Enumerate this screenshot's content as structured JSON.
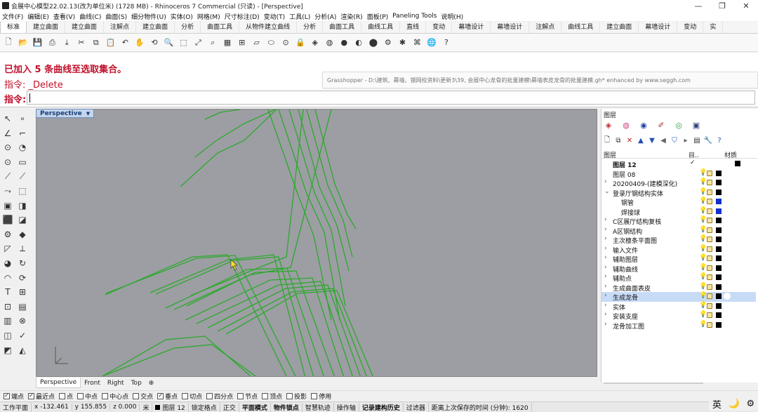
{
  "window": {
    "title": "会展中心模型22.02.13(改为单位米) (1728 MB) - Rhinoceros 7 Commercial (只读) - [Perspective]",
    "controls": [
      "—",
      "❐",
      "✕"
    ]
  },
  "menu": [
    "文件(F)",
    "编辑(E)",
    "查看(V)",
    "曲线(C)",
    "曲面(S)",
    "细分物件(U)",
    "实体(O)",
    "网格(M)",
    "尺寸标注(D)",
    "变动(T)",
    "工具(L)",
    "分析(A)",
    "渲染(R)",
    "面板(P)",
    "Paneling Tools",
    "说明(H)"
  ],
  "tabs": [
    "标准",
    "建立曲面",
    "建立曲面",
    "注解点",
    "建立曲面",
    "分析",
    "曲面工具",
    "从物件建立曲线",
    "分析",
    "曲面工具",
    "曲线工具",
    "直线",
    "变动",
    "幕墙设计",
    "幕墙设计",
    "注解点",
    "曲线工具",
    "建立曲面",
    "幕墙设计",
    "变动",
    "实"
  ],
  "active_tab_index": 0,
  "toolbar_icons": [
    {
      "name": "new-icon",
      "glyph": "🗋"
    },
    {
      "name": "open-icon",
      "glyph": "📂"
    },
    {
      "name": "save-icon",
      "glyph": "💾"
    },
    {
      "name": "print-icon",
      "glyph": "⎙"
    },
    {
      "name": "import-icon",
      "glyph": "⤓"
    },
    {
      "name": "cut-icon",
      "glyph": "✂"
    },
    {
      "name": "copy-icon",
      "glyph": "⧉"
    },
    {
      "name": "paste-icon",
      "glyph": "📋"
    },
    {
      "name": "undo-icon",
      "glyph": "↶"
    },
    {
      "name": "pan-icon",
      "glyph": "✋"
    },
    {
      "name": "rotate-view-icon",
      "glyph": "⟲"
    },
    {
      "name": "zoom-icon",
      "glyph": "🔍"
    },
    {
      "name": "zoom-window-icon",
      "glyph": "⬚"
    },
    {
      "name": "zoom-extents-icon",
      "glyph": "⤢"
    },
    {
      "name": "zoom-selected-icon",
      "glyph": "⌕"
    },
    {
      "name": "viewport-layout-icon",
      "glyph": "▦"
    },
    {
      "name": "set-view-icon",
      "glyph": "⊞"
    },
    {
      "name": "cplane-icon",
      "glyph": "▱"
    },
    {
      "name": "select-icon",
      "glyph": "⬭"
    },
    {
      "name": "osnap-icon",
      "glyph": "⊙"
    },
    {
      "name": "lock-icon",
      "glyph": "🔒"
    },
    {
      "name": "layer-icon",
      "glyph": "◈"
    },
    {
      "name": "color-wheel-icon",
      "glyph": "◍"
    },
    {
      "name": "material-icon",
      "glyph": "●"
    },
    {
      "name": "render-icon",
      "glyph": "◐"
    },
    {
      "name": "sphere-icon",
      "glyph": "⬤"
    },
    {
      "name": "options-icon",
      "glyph": "⚙"
    },
    {
      "name": "grasshopper-icon",
      "glyph": "✱"
    },
    {
      "name": "script-icon",
      "glyph": "⌘"
    },
    {
      "name": "globe-icon",
      "glyph": "🌐"
    },
    {
      "name": "help-icon",
      "glyph": "?"
    }
  ],
  "command": {
    "history_1": "已加入 5 条曲线至选取集合。",
    "history_2": "指令: _Delete",
    "prompt": "指令:",
    "input": ""
  },
  "grasshopper_title": "Grasshopper - D:\\建筑、幕墙、钢网校资料\\更新3\\39, 会展中心龙骨的批量建模\\幕墙表皮龙骨的批量建模.gh* enhanced by www.seggh.com",
  "viewport": {
    "label": "Perspective",
    "curve_color": "#2ea82e",
    "background": "#9c9ea3"
  },
  "view_tabs": [
    "Perspective",
    "Front",
    "Right",
    "Top",
    "⊕"
  ],
  "active_view_tab": 0,
  "osnaps": [
    {
      "label": "端点",
      "checked": true
    },
    {
      "label": "最近点",
      "checked": true
    },
    {
      "label": "点",
      "checked": false
    },
    {
      "label": "中点",
      "checked": false
    },
    {
      "label": "中心点",
      "checked": false
    },
    {
      "label": "交点",
      "checked": false
    },
    {
      "label": "垂点",
      "checked": true
    },
    {
      "label": "切点",
      "checked": false
    },
    {
      "label": "四分点",
      "checked": false
    },
    {
      "label": "节点",
      "checked": false
    },
    {
      "label": "顶点",
      "checked": false
    },
    {
      "label": "投影",
      "checked": false
    },
    {
      "label": "停用",
      "checked": false
    }
  ],
  "status": {
    "cplane": "工作平面",
    "x": "x -132.461",
    "y": "y 155.855",
    "z": "z 0.000",
    "unit": "米",
    "layer": "图层 12",
    "items": [
      "锁定格点",
      "正交",
      "平面模式",
      "物件锁点",
      "智慧轨迹",
      "操作轴",
      "记录建构历史",
      "过滤器",
      "距离上次保存的时间 (分钟): 1620"
    ],
    "bold_items": [
      2,
      3,
      6
    ]
  },
  "system_tray": [
    "英",
    "🌙",
    "⚙"
  ],
  "layer_panel": {
    "title": "图层",
    "header_layer": "图层",
    "header_mat": "材质",
    "header_cur": "目..",
    "rows": [
      {
        "name": "图层 12",
        "expand": "",
        "indent": 0,
        "bold": true,
        "current": true,
        "color": "#000000",
        "selected": false
      },
      {
        "name": "图层 08",
        "expand": "",
        "indent": 0,
        "bold": false,
        "current": false,
        "color": "#000000",
        "selected": false
      },
      {
        "name": "20200409-(建模深化)",
        "expand": "›",
        "indent": 0,
        "bold": false,
        "current": false,
        "color": "#000000",
        "selected": false
      },
      {
        "name": "登录厅钢结构实体",
        "expand": "⌄",
        "indent": 0,
        "bold": false,
        "current": false,
        "color": "#000000",
        "selected": false
      },
      {
        "name": "钢管",
        "expand": "",
        "indent": 1,
        "bold": false,
        "current": false,
        "color": "#1030d0",
        "selected": false
      },
      {
        "name": "焊接球",
        "expand": "",
        "indent": 1,
        "bold": false,
        "current": false,
        "color": "#1030d0",
        "selected": false
      },
      {
        "name": "C区展厅结构复核",
        "expand": "›",
        "indent": 0,
        "bold": false,
        "current": false,
        "color": "#000000",
        "selected": false
      },
      {
        "name": "A区钢结构",
        "expand": "›",
        "indent": 0,
        "bold": false,
        "current": false,
        "color": "#000000",
        "selected": false
      },
      {
        "name": "主次檩条平面图",
        "expand": "›",
        "indent": 0,
        "bold": false,
        "current": false,
        "color": "#000000",
        "selected": false
      },
      {
        "name": "输入文件",
        "expand": "›",
        "indent": 0,
        "bold": false,
        "current": false,
        "color": "#000000",
        "selected": false
      },
      {
        "name": "辅助图层",
        "expand": "›",
        "indent": 0,
        "bold": false,
        "current": false,
        "color": "#000000",
        "selected": false
      },
      {
        "name": "辅助曲线",
        "expand": "›",
        "indent": 0,
        "bold": false,
        "current": false,
        "color": "#000000",
        "selected": false
      },
      {
        "name": "辅助点",
        "expand": "›",
        "indent": 0,
        "bold": false,
        "current": false,
        "color": "#000000",
        "selected": false
      },
      {
        "name": "生成曲面表皮",
        "expand": "›",
        "indent": 0,
        "bold": false,
        "current": false,
        "color": "#000000",
        "selected": false
      },
      {
        "name": "生成龙骨",
        "expand": "›",
        "indent": 0,
        "bold": false,
        "current": false,
        "color": "#000000",
        "selected": true
      },
      {
        "name": "实体",
        "expand": "›",
        "indent": 0,
        "bold": false,
        "current": false,
        "color": "#000000",
        "selected": false
      },
      {
        "name": "安装支座",
        "expand": "›",
        "indent": 0,
        "bold": false,
        "current": false,
        "color": "#000000",
        "selected": false
      },
      {
        "name": "龙骨加工图",
        "expand": "›",
        "indent": 0,
        "bold": false,
        "current": false,
        "color": "#000000",
        "selected": false
      }
    ]
  }
}
